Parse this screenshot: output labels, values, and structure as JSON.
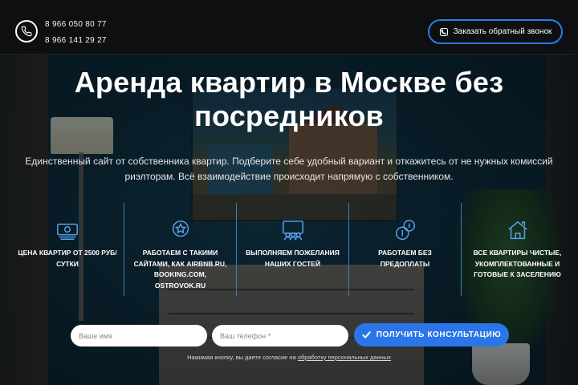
{
  "header": {
    "phones": [
      "8 966 050 80 77",
      "8 966 141 29 27"
    ],
    "callback_label": "Заказать обратный звонок",
    "phone_icon": "phone-icon"
  },
  "hero": {
    "title": "Аренда квартир в Москве без посредников",
    "subtitle": "Единственный сайт от собственника квартир. Подберите себе удобный вариант и откажитесь от не нужных комиссий риэлторам. Всё взаимодействие происходит напрямую с собственником."
  },
  "features": [
    {
      "icon": "money-icon",
      "text": "Цена квартир от 2500 руб/сутки"
    },
    {
      "icon": "star-badge-icon",
      "text": "Работаем с такими сайтами, как airbnb.ru, booking.com, ostrovok.ru"
    },
    {
      "icon": "group-icon",
      "text": "Выполняем пожелания наших гостей"
    },
    {
      "icon": "coins-icon",
      "text": "Работаем без предоплаты"
    },
    {
      "icon": "house-icon",
      "text": "Все квартиры чистые, укомплектованные и готовые к заселению"
    }
  ],
  "form": {
    "name_placeholder": "Ваше имя",
    "phone_placeholder": "Ваш телефон *",
    "submit_label": "ПОЛУЧИТЬ КОНСУЛЬТАЦИЮ",
    "consent_text": "Нажимая кнопку, вы даете согласие на",
    "consent_link": "обработку персональных данных"
  },
  "colors": {
    "accent": "#2a75e8",
    "header_bg": "#0d0f11",
    "divider": "#3f7fb8"
  }
}
